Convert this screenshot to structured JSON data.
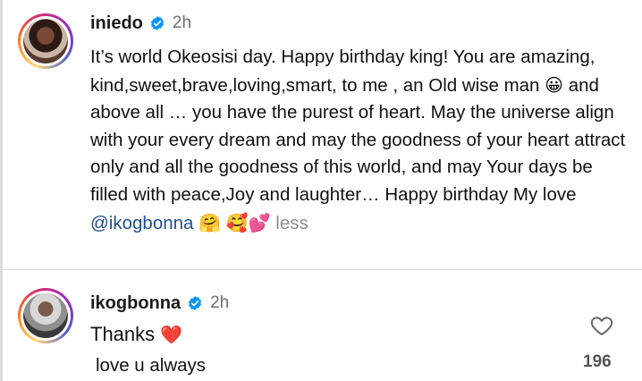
{
  "post": {
    "username": "iniedo",
    "timestamp": "2h",
    "text_1": "It’s world Okeosisi day. Happy birthday king! You are amazing, kind,sweet,brave,loving,smart, to me , an Old wise man ",
    "emoji_grin": "😀",
    "text_2": " and above all … you have the purest of heart. May the universe align with your every dream and may the goodness of your heart attract only and all the goodness of this world, and may Your days be filled with peace,Joy and laughter…  Happy birthday My love ",
    "mention": "@ikogbonna",
    "emoji_hug": "🤗",
    "emoji_hearts": "🥰💕",
    "less_label": "less"
  },
  "comment": {
    "username": "ikogbonna",
    "timestamp": "2h",
    "text": "Thanks",
    "emoji_heart": "❤️",
    "text_line2": "love u always",
    "like_count": "196"
  },
  "icons": {
    "verified": "verified-badge-icon",
    "like": "heart-outline-icon"
  },
  "colors": {
    "verified_blue": "#0095f6",
    "mention_blue": "#1e4f8c",
    "heart_red": "#e0245e"
  }
}
